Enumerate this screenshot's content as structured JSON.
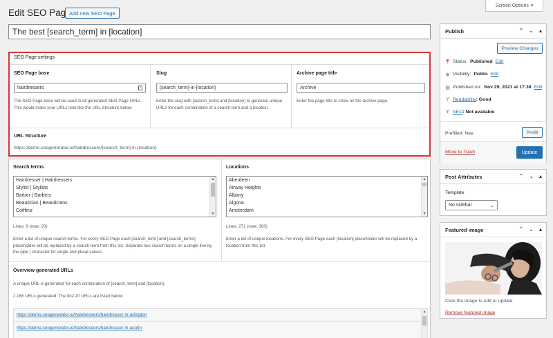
{
  "header": {
    "screen_options": "Screen Options",
    "page_title": "Edit SEO Page",
    "add_new": "Add new SEO Page",
    "post_title": "The best [search_term] in [location]"
  },
  "settings": {
    "title": "SEO Page settings",
    "base": {
      "label": "SEO Page base",
      "value": "hairdressers",
      "desc": "The SEO Page base will be used in all generated SEO Page URLs. This would make your URLs look like the URL Structure below."
    },
    "slug": {
      "label": "Slug",
      "value": "[search_term]-in-[location]",
      "desc": "Enter the slug with [search_term] and [location] to generate unique URLs for each combination of a search term and a location."
    },
    "archive": {
      "label": "Archive page title",
      "value": "Archive",
      "desc": "Enter the page title to show on the archive page."
    },
    "url_structure": {
      "label": "URL Structure",
      "value": "https://demo.seogenerator.io/hairdressers/[search_term]-in-[location]"
    }
  },
  "search_terms": {
    "label": "Search terms",
    "items": [
      "Hairdresser | Hairdressers",
      "Stylist | Stylists",
      "Barber | Barbers",
      "Beautician | Beauticians",
      "Coiffeur"
    ],
    "lines": "Lines: 8 (max: 20)",
    "desc": "Enter a list of unique search terms. For every SEO Page each [search_term] and [search_terms] placeholder will be replaced by a search term from this list. Separate two search terms on a single line by the pipe | character for single and plural values"
  },
  "locations": {
    "label": "Locations",
    "items": [
      "Aberdeen",
      "Airway Heights",
      "Albany",
      "Algona",
      "Amsterdam"
    ],
    "lines": "Lines: 271 (max: 300)",
    "desc": "Enter a list of unique locations. For every SEO Page each [location] placeholder will be replaced by a location from this list."
  },
  "overview": {
    "title": "Overview generated URLs",
    "desc": "A unique URL is generated for each combination of [search_term] and [location].",
    "count": "2.168 URLs generated. The first 20 URLs are listed below.",
    "urls": [
      "https://demo.seogenerator.io/hairdressers/hairdresser-in-arlington",
      "https://demo.seogenerator.io/hairdressers/hairdresser-in-asotin"
    ]
  },
  "publish": {
    "title": "Publish",
    "preview": "Preview Changes",
    "status_label": "Status:",
    "status_value": "Published",
    "status_edit": "Edit",
    "visibility_label": "Visibility:",
    "visibility_value": "Public",
    "visibility_edit": "Edit",
    "published_label": "Published on:",
    "published_value": "Nov 29, 2021 at 17:38",
    "published_edit": "Edit",
    "readability_label": "Readability",
    "readability_value": ": Good",
    "seo_label": "SEO",
    "seo_value": ": Not available",
    "prefilled": "Prefilled: Nee",
    "prefill_btn": "Prefill",
    "trash": "Move to Trash",
    "update": "Update"
  },
  "attributes": {
    "title": "Post Attributes",
    "template_label": "Template",
    "template_value": "No sidebar"
  },
  "featured": {
    "title": "Featured image",
    "hint": "Click the image to edit or update",
    "remove": "Remove featured image"
  },
  "colors": {
    "accent": "#2271b1",
    "highlight": "#d63638",
    "readability": "#7ad03a"
  }
}
